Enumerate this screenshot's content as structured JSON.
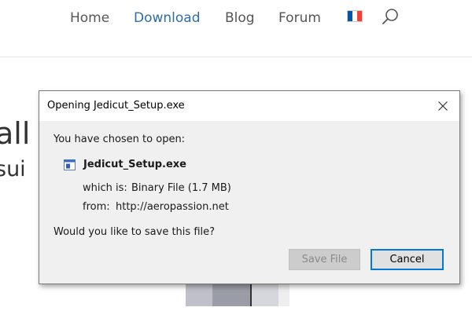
{
  "nav": {
    "items": [
      "Home",
      "Download",
      "Blog",
      "Forum"
    ],
    "active": "Download",
    "flag_icon": "french-flag-icon",
    "search_icon": "search-icon"
  },
  "background": {
    "title_fragment": "all",
    "subtitle_fragment": "sui"
  },
  "dialog": {
    "title": "Opening Jedicut_Setup.exe",
    "prompt": "You have chosen to open:",
    "file_name": "Jedicut_Setup.exe",
    "which_label": "which is:",
    "which_value": "Binary File (1.7 MB)",
    "from_label": "from:",
    "from_value": "http://aeropassion.net",
    "question": "Would you like to save this file?",
    "save_button": "Save File",
    "cancel_button": "Cancel",
    "close_icon": "close-icon"
  },
  "colors": {
    "nav_active": "#2e6da4",
    "nav_text": "#555555",
    "dialog_bg": "#f0f0f0",
    "focus_border": "#0078d7"
  }
}
